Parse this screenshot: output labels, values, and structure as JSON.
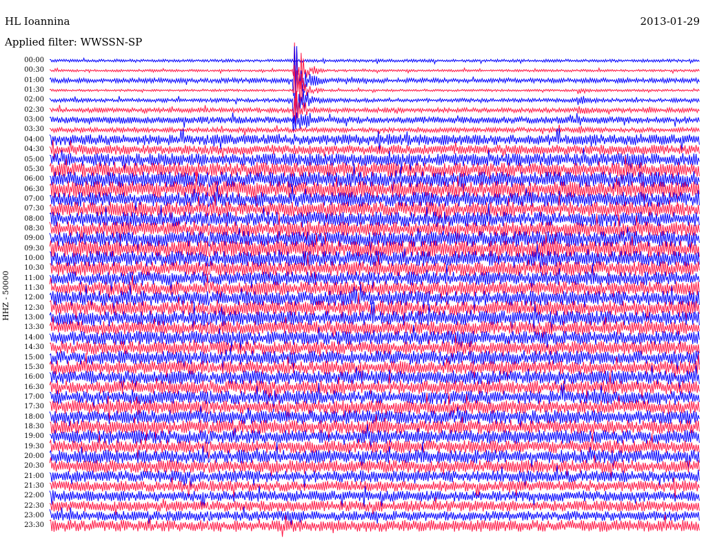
{
  "header": {
    "station": "HL Ioannina",
    "date": "2013-01-29",
    "filter": "Applied filter: WWSSN-SP"
  },
  "chart_data": {
    "type": "line",
    "title": "HL Ioannina",
    "ylabel": "HHZ - 50000",
    "xlabel": "",
    "grid": false,
    "y_tick_labels": [
      "00:00",
      "00:30",
      "01:00",
      "01:30",
      "02:00",
      "02:30",
      "03:00",
      "03:30",
      "04:00",
      "04:30",
      "05:00",
      "05:30",
      "06:00",
      "06:30",
      "07:00",
      "07:30",
      "08:00",
      "08:30",
      "09:00",
      "09:30",
      "10:00",
      "10:30",
      "11:00",
      "11:30",
      "12:00",
      "12:30",
      "13:00",
      "13:30",
      "14:00",
      "14:30",
      "15:00",
      "15:30",
      "16:00",
      "16:30",
      "17:00",
      "17:30",
      "18:00",
      "18:30",
      "19:00",
      "19:30",
      "20:00",
      "20:30",
      "21:00",
      "21:30",
      "22:00",
      "22:30",
      "23:00",
      "23:30"
    ],
    "trace_colors": [
      "#0000ff",
      "#ff1744"
    ],
    "amplitude_by_hour": [
      0.15,
      0.12,
      0.25,
      0.12,
      0.2,
      0.25,
      0.35,
      0.25,
      0.55,
      0.5,
      0.65,
      0.75,
      0.8,
      0.85,
      0.75,
      0.75,
      0.75,
      0.75,
      0.8,
      0.85,
      0.8,
      0.75,
      0.7,
      0.7,
      0.75,
      0.75,
      0.75,
      0.7,
      0.7,
      0.7,
      0.7,
      0.7,
      0.7,
      0.7,
      0.7,
      0.7,
      0.7,
      0.7,
      0.7,
      0.65,
      0.7,
      0.65,
      0.6,
      0.55,
      0.55,
      0.55,
      0.5,
      0.6
    ],
    "events": [
      {
        "row": 1,
        "x_fraction": 0.38,
        "amplitude": 14,
        "label": "large event near 00:30-03:00"
      },
      {
        "row": 3,
        "x_fraction": 0.815,
        "amplitude": 1.5,
        "label": "event near 01:30"
      }
    ]
  }
}
